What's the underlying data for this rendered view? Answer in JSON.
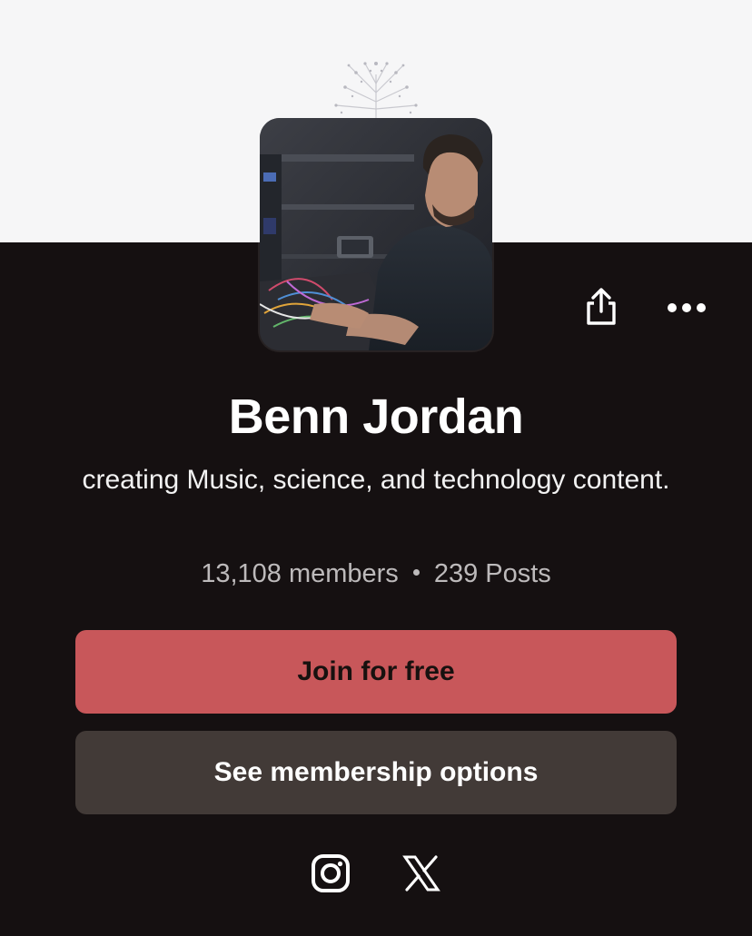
{
  "creator": {
    "name": "Benn Jordan",
    "tagline": "creating Music, science, and technology content.",
    "members": "13,108 members",
    "posts": "239 Posts"
  },
  "actions": {
    "join_label": "Join for free",
    "options_label": "See membership options"
  },
  "icons": {
    "share": "share-icon",
    "more": "more-horizontal-icon",
    "instagram": "instagram-icon",
    "x": "x-logo-icon"
  },
  "colors": {
    "banner": "#f6f6f7",
    "background": "#151011",
    "join_button": "#c8575a",
    "options_button": "#423a37"
  }
}
